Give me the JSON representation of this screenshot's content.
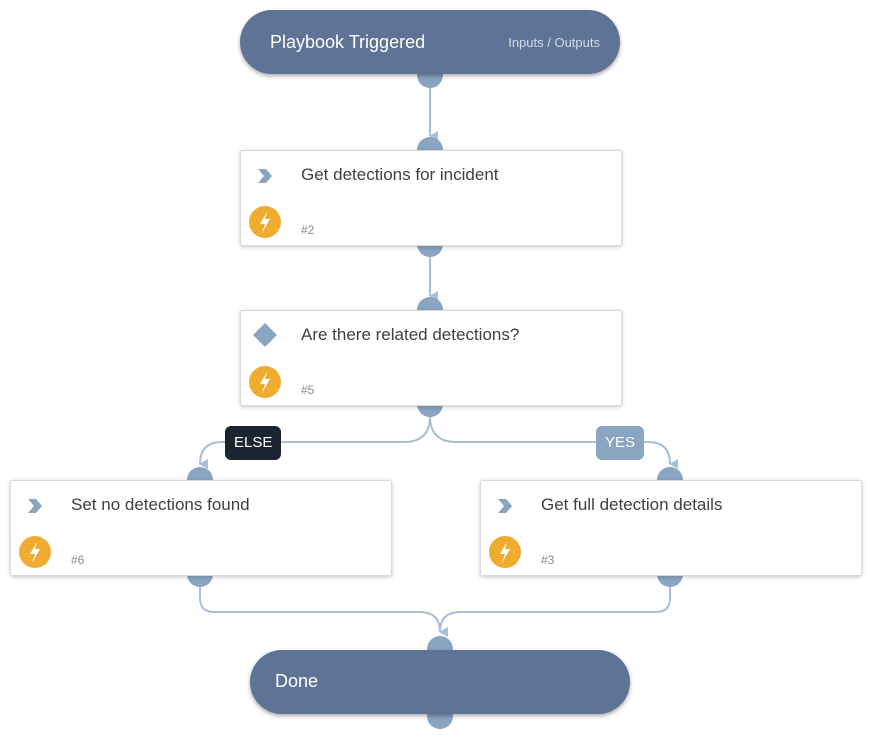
{
  "colors": {
    "pill_background": "#5f7397",
    "connector": "#a9bfd6",
    "port": "#8aa5c2",
    "lightning": "#f0ac31",
    "else_label": "#1c2331",
    "yes_label": "#8aa5c2"
  },
  "start_node": {
    "title": "Playbook Triggered",
    "io_link": "Inputs / Outputs"
  },
  "tasks": [
    {
      "name": "Get detections for incident",
      "number": "#2",
      "type_icon": "chevron-right-icon",
      "status_icon": "lightning-icon"
    },
    {
      "name": "Are there related detections?",
      "number": "#5",
      "type_icon": "diamond-icon",
      "status_icon": "lightning-icon"
    },
    {
      "name": "Set no detections found",
      "number": "#6",
      "type_icon": "chevron-right-icon",
      "status_icon": "lightning-icon"
    },
    {
      "name": "Get full detection details",
      "number": "#3",
      "type_icon": "chevron-right-icon",
      "status_icon": "lightning-icon"
    }
  ],
  "branch_labels": {
    "else": "ELSE",
    "yes": "YES"
  },
  "end_node": {
    "title": "Done"
  }
}
